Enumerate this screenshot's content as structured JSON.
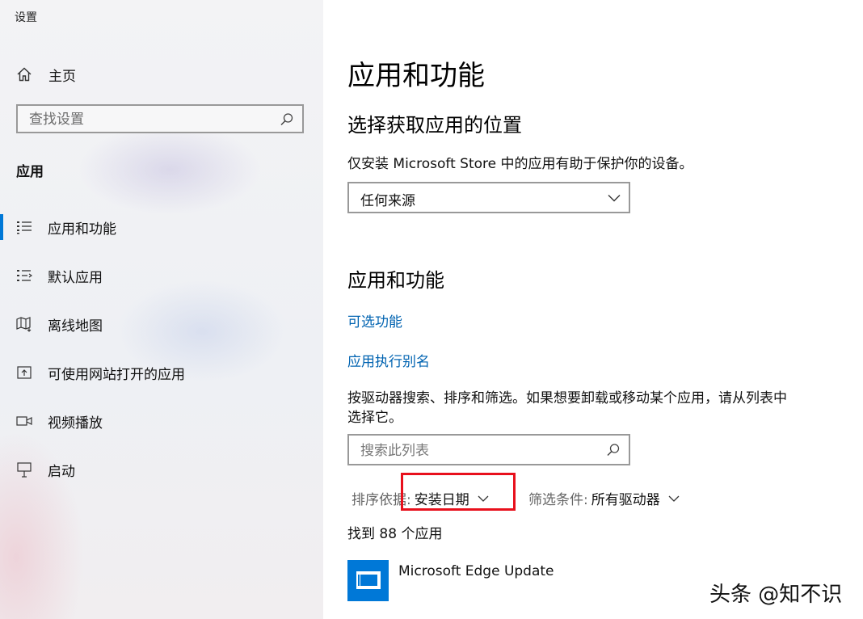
{
  "window": {
    "title": "设置"
  },
  "sidebar": {
    "home_label": "主页",
    "search_placeholder": "查找设置",
    "section_title": "应用",
    "items": [
      {
        "label": "应用和功能",
        "icon": "apps-list-icon",
        "selected": true
      },
      {
        "label": "默认应用",
        "icon": "default-apps-icon",
        "selected": false
      },
      {
        "label": "离线地图",
        "icon": "offline-map-icon",
        "selected": false
      },
      {
        "label": "可使用网站打开的应用",
        "icon": "website-open-icon",
        "selected": false
      },
      {
        "label": "视频播放",
        "icon": "video-icon",
        "selected": false
      },
      {
        "label": "启动",
        "icon": "startup-icon",
        "selected": false
      }
    ]
  },
  "main": {
    "page_title": "应用和功能",
    "source_section": {
      "heading": "选择获取应用的位置",
      "description": "仅安装 Microsoft Store 中的应用有助于保护你的设备。",
      "dropdown_value": "任何来源"
    },
    "apps_section": {
      "heading": "应用和功能",
      "link_optional_features": "可选功能",
      "link_app_aliases": "应用执行别名",
      "description_line1": "按驱动器搜索、排序和筛选。如果想要卸载或移动某个应用，请从列表中",
      "description_line2": "选择它。",
      "search_placeholder": "搜索此列表",
      "sort_label": "排序依据:",
      "sort_value": "安装日期",
      "filter_label": "筛选条件:",
      "filter_value": "所有驱动器",
      "count_text": "找到 88 个应用",
      "apps": [
        {
          "name": "Microsoft Edge Update"
        }
      ]
    }
  },
  "watermark": {
    "text": "头条 @知不识"
  },
  "colors": {
    "accent": "#0078d7",
    "link": "#0063b1",
    "highlight": "#e8101c"
  }
}
